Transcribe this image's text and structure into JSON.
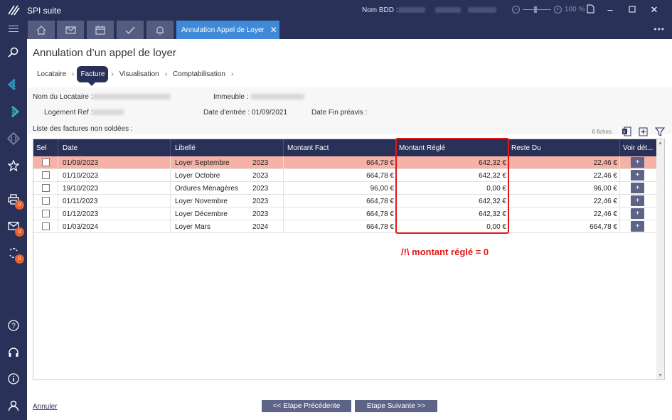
{
  "app": {
    "title": "SPI suite",
    "bdd_label": "Nom BDD :",
    "zoom": "100 %",
    "icons": [
      "spi-logo-icon",
      "document-icon",
      "minimize-icon",
      "maximize-icon",
      "close-icon"
    ]
  },
  "tabs": {
    "icon_tabs": [
      "home-icon",
      "mail-icon",
      "calendar-icon",
      "check-icon",
      "bell-icon"
    ],
    "active_label": "Annulation Appel de Loyer",
    "more": "•••"
  },
  "sidebar": {
    "badges": [
      "0",
      "0",
      "0"
    ]
  },
  "page": {
    "title": "Annulation d’un appel de loyer",
    "steps": [
      "Locataire",
      "Facture",
      "Visualisation",
      "Comptabilisation"
    ],
    "active_step": "Facture",
    "fields": {
      "locataire_label": "Nom du Locataire :",
      "immeuble_label": "Immeuble :",
      "logement_label": "Logement Ref :",
      "date_entree_label": "Date d'entrée :",
      "date_entree_value": "01/09/2021",
      "date_fin_label": "Date Fin préavis :"
    },
    "list_label": "Liste des factures non soldées :",
    "count": "6 fiches"
  },
  "grid": {
    "columns": [
      "Sel",
      "Date",
      "Libellé",
      "Montant Fact",
      "Montant Réglé",
      "Reste Du",
      "Voir dét..."
    ],
    "rows": [
      {
        "date": "01/09/2023",
        "libelle": "Loyer Septembre",
        "annee": "2023",
        "fact": "664,78 €",
        "regle": "642,32 €",
        "reste": "22,46 €",
        "selected": true
      },
      {
        "date": "01/10/2023",
        "libelle": "Loyer Octobre",
        "annee": "2023",
        "fact": "664,78 €",
        "regle": "642,32 €",
        "reste": "22,46 €",
        "selected": false
      },
      {
        "date": "19/10/2023",
        "libelle": "Ordures Ménagères",
        "annee": "2023",
        "fact": "96,00 €",
        "regle": "0,00 €",
        "reste": "96,00 €",
        "selected": false
      },
      {
        "date": "01/11/2023",
        "libelle": "Loyer Novembre",
        "annee": "2023",
        "fact": "664,78 €",
        "regle": "642,32 €",
        "reste": "22,46 €",
        "selected": false
      },
      {
        "date": "01/12/2023",
        "libelle": "Loyer Décembre",
        "annee": "2023",
        "fact": "664,78 €",
        "regle": "642,32 €",
        "reste": "22,46 €",
        "selected": false
      },
      {
        "date": "01/03/2024",
        "libelle": "Loyer Mars",
        "annee": "2024",
        "fact": "664,78 €",
        "regle": "0,00 €",
        "reste": "664,78 €",
        "selected": false
      }
    ],
    "detail_button": "+"
  },
  "annotation": {
    "text": "/!\\ montant réglé = 0",
    "color": "#e01818"
  },
  "footer": {
    "cancel": "Annuler",
    "prev": "<< Etape Précédente",
    "next": "Etape Suivante >>"
  },
  "colors": {
    "navy": "#2a3158",
    "tab_active": "#3f8ad8",
    "selected_row": "#f6b2a6",
    "badge": "#e8602c"
  }
}
